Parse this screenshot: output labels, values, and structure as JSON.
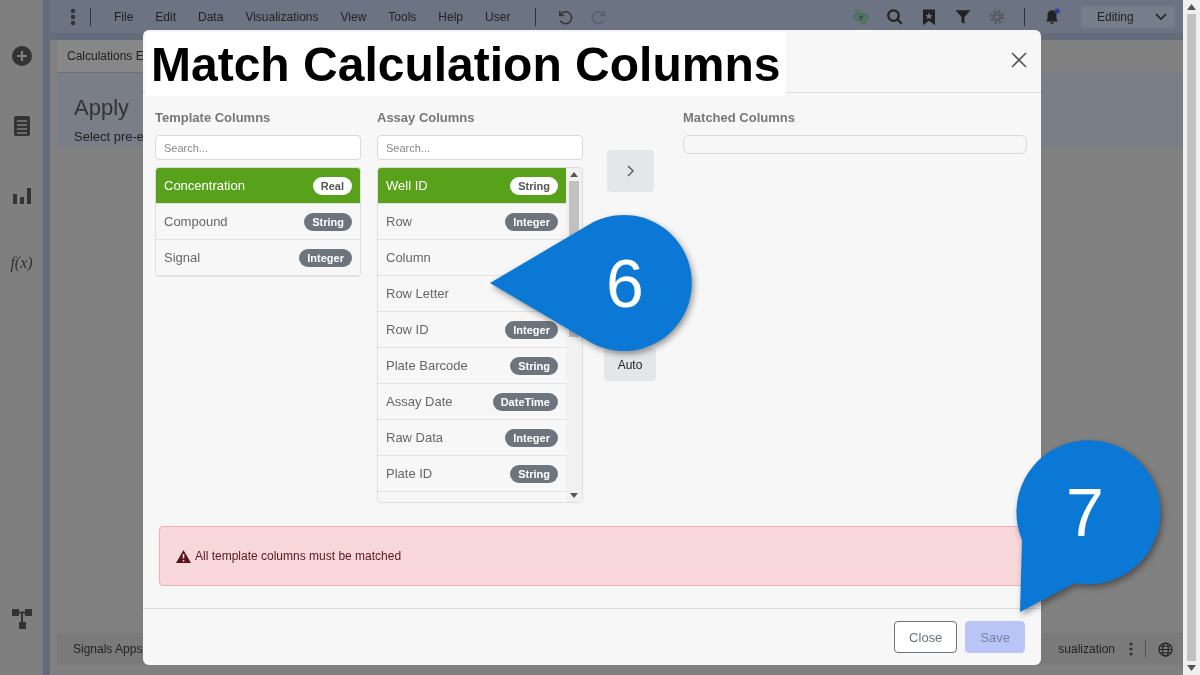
{
  "menubar": {
    "items": [
      "File",
      "Edit",
      "Data",
      "Visualizations",
      "View",
      "Tools",
      "Help",
      "User"
    ],
    "mode": "Editing"
  },
  "sidebar": {
    "function_label": "f(x)"
  },
  "page": {
    "tab": "Calculations E",
    "heading": "Apply",
    "subheading": "Select pre-e"
  },
  "bottom_bar": {
    "left": "Signals Apps",
    "right": "sualization"
  },
  "dialog": {
    "title": "Match Calculation Columns",
    "template": {
      "heading": "Template Columns",
      "placeholder": "Search...",
      "items": [
        {
          "name": "Concentration",
          "type": "Real",
          "selected": true
        },
        {
          "name": "Compound",
          "type": "String",
          "selected": false
        },
        {
          "name": "Signal",
          "type": "Integer",
          "selected": false
        }
      ]
    },
    "assay": {
      "heading": "Assay Columns",
      "placeholder": "Search...",
      "items": [
        {
          "name": "Well ID",
          "type": "String",
          "selected": true
        },
        {
          "name": "Row",
          "type": "Integer",
          "selected": false
        },
        {
          "name": "Column",
          "selected": false
        },
        {
          "name": "Row Letter",
          "selected": false
        },
        {
          "name": "Row ID",
          "type": "Integer",
          "selected": false
        },
        {
          "name": "Plate Barcode",
          "type": "String",
          "selected": false
        },
        {
          "name": "Assay Date",
          "type": "DateTime",
          "selected": false
        },
        {
          "name": "Raw Data",
          "type": "Integer",
          "selected": false
        },
        {
          "name": "Plate ID",
          "type": "String",
          "selected": false
        }
      ]
    },
    "auto_button": "Auto",
    "matched": {
      "heading": "Matched Columns"
    },
    "alert": "All template columns must be matched",
    "buttons": [
      {
        "label": "Close",
        "disabled": false
      },
      {
        "label": "Save",
        "disabled": true
      }
    ]
  },
  "callouts": [
    {
      "number": "6"
    },
    {
      "number": "7"
    }
  ]
}
